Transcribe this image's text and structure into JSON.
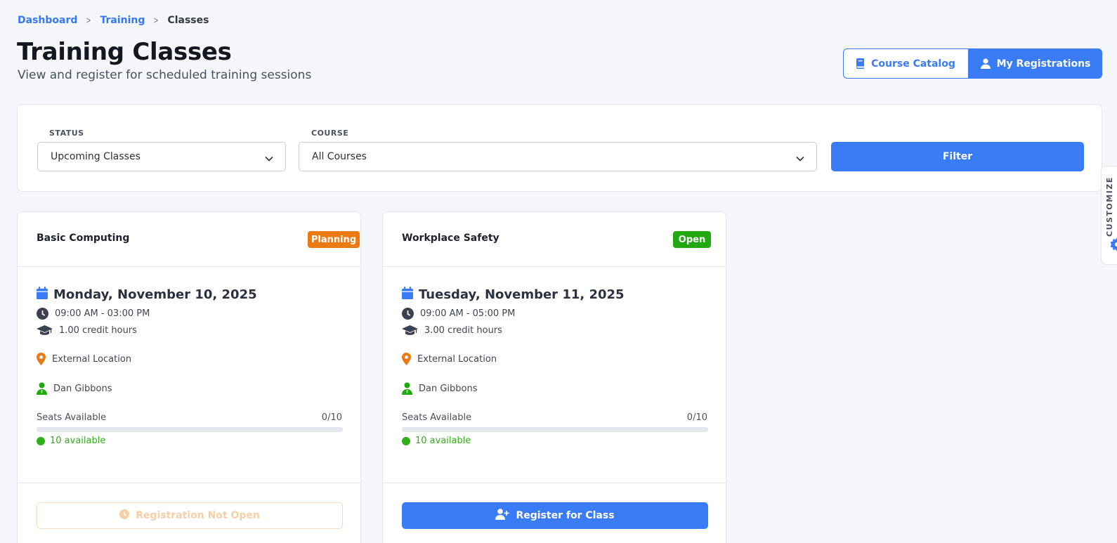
{
  "breadcrumb": {
    "items": [
      "Dashboard",
      "Training"
    ],
    "current": "Classes"
  },
  "header": {
    "title": "Training Classes",
    "subtitle": "View and register for scheduled training sessions",
    "catalog_label": "Course Catalog",
    "registrations_label": "My Registrations"
  },
  "filters": {
    "status_label": "STATUS",
    "status_value": "Upcoming Classes",
    "course_label": "COURSE",
    "course_value": "All Courses",
    "filter_button": "Filter"
  },
  "customize": {
    "label": "CUSTOMIZE"
  },
  "colors": {
    "primary": "#3a7bf6",
    "planning_badge": "#ec7a12",
    "open_badge": "#22a912",
    "available_green": "#2fb01b",
    "location_orange": "#ec7a12"
  },
  "classes": [
    {
      "course": "Basic Computing",
      "status": "Planning",
      "date": "Monday, November 10, 2025",
      "time": "09:00 AM - 03:00 PM",
      "credits": "1.00 credit hours",
      "location": "External Location",
      "instructor": "Dan Gibbons",
      "seats_label": "Seats Available",
      "seats_count": "0/10",
      "seats_filled_fraction": 0,
      "available": "10 available",
      "action": "Registration Not Open",
      "action_enabled": false
    },
    {
      "course": "Workplace Safety",
      "status": "Open",
      "date": "Tuesday, November 11, 2025",
      "time": "09:00 AM - 05:00 PM",
      "credits": "3.00 credit hours",
      "location": "External Location",
      "instructor": "Dan Gibbons",
      "seats_label": "Seats Available",
      "seats_count": "0/10",
      "seats_filled_fraction": 0,
      "available": "10 available",
      "action": "Register for Class",
      "action_enabled": true
    }
  ]
}
